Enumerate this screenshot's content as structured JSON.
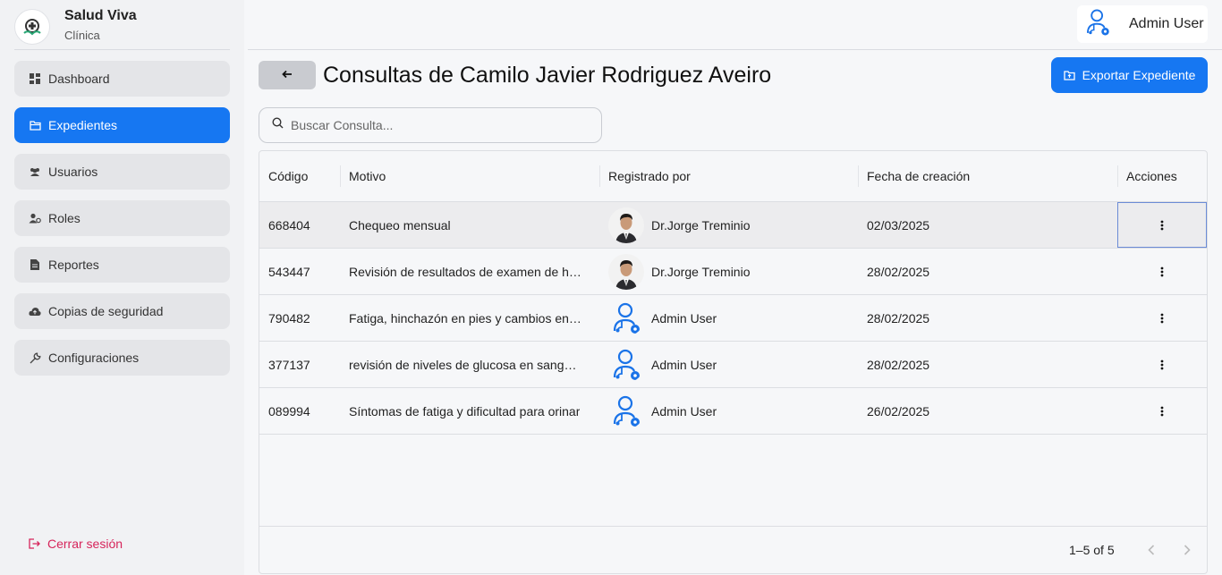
{
  "brand": {
    "name": "Salud Viva",
    "subtitle": "Clínica",
    "logo_icon": "medical-cross-icon"
  },
  "sidebar": {
    "items": [
      {
        "label": "Dashboard",
        "icon": "dashboard-icon",
        "active": false
      },
      {
        "label": "Expedientes",
        "icon": "folder-icon",
        "active": true
      },
      {
        "label": "Usuarios",
        "icon": "users-icon",
        "active": false
      },
      {
        "label": "Roles",
        "icon": "user-role-icon",
        "active": false
      },
      {
        "label": "Reportes",
        "icon": "document-icon",
        "active": false
      },
      {
        "label": "Copias de seguridad",
        "icon": "cloud-icon",
        "active": false
      },
      {
        "label": "Configuraciones",
        "icon": "wrench-icon",
        "active": false
      }
    ],
    "logout_label": "Cerrar sesión"
  },
  "topbar": {
    "user_name": "Admin User"
  },
  "header": {
    "title": "Consultas de Camilo Javier Rodriguez Aveiro",
    "export_label": "Exportar Expediente"
  },
  "search": {
    "placeholder": "Buscar Consulta...",
    "value": ""
  },
  "table": {
    "columns": [
      "Código",
      "Motivo",
      "Registrado por",
      "Fecha de creación",
      "Acciones"
    ],
    "rows": [
      {
        "codigo": "668404",
        "motivo": "Chequeo mensual",
        "registrado_por": "Dr.Jorge Treminio",
        "avatar": "photo",
        "fecha": "02/03/2025"
      },
      {
        "codigo": "543447",
        "motivo": "Revisión de resultados de examen de h…",
        "registrado_por": "Dr.Jorge Treminio",
        "avatar": "photo",
        "fecha": "28/02/2025"
      },
      {
        "codigo": "790482",
        "motivo": "Fatiga, hinchazón en pies y cambios en…",
        "registrado_por": "Admin User",
        "avatar": "admin",
        "fecha": "28/02/2025"
      },
      {
        "codigo": "377137",
        "motivo": "revisión de niveles de glucosa en sang…",
        "registrado_por": "Admin User",
        "avatar": "admin",
        "fecha": "28/02/2025"
      },
      {
        "codigo": "089994",
        "motivo": "Síntomas de fatiga y dificultad para orinar",
        "registrado_por": "Admin User",
        "avatar": "admin",
        "fecha": "26/02/2025"
      }
    ],
    "pagination": "1–5 of 5"
  },
  "colors": {
    "accent": "#1677f2",
    "logout": "#d6245a",
    "sidebar_bg": "#f1f2f4"
  }
}
